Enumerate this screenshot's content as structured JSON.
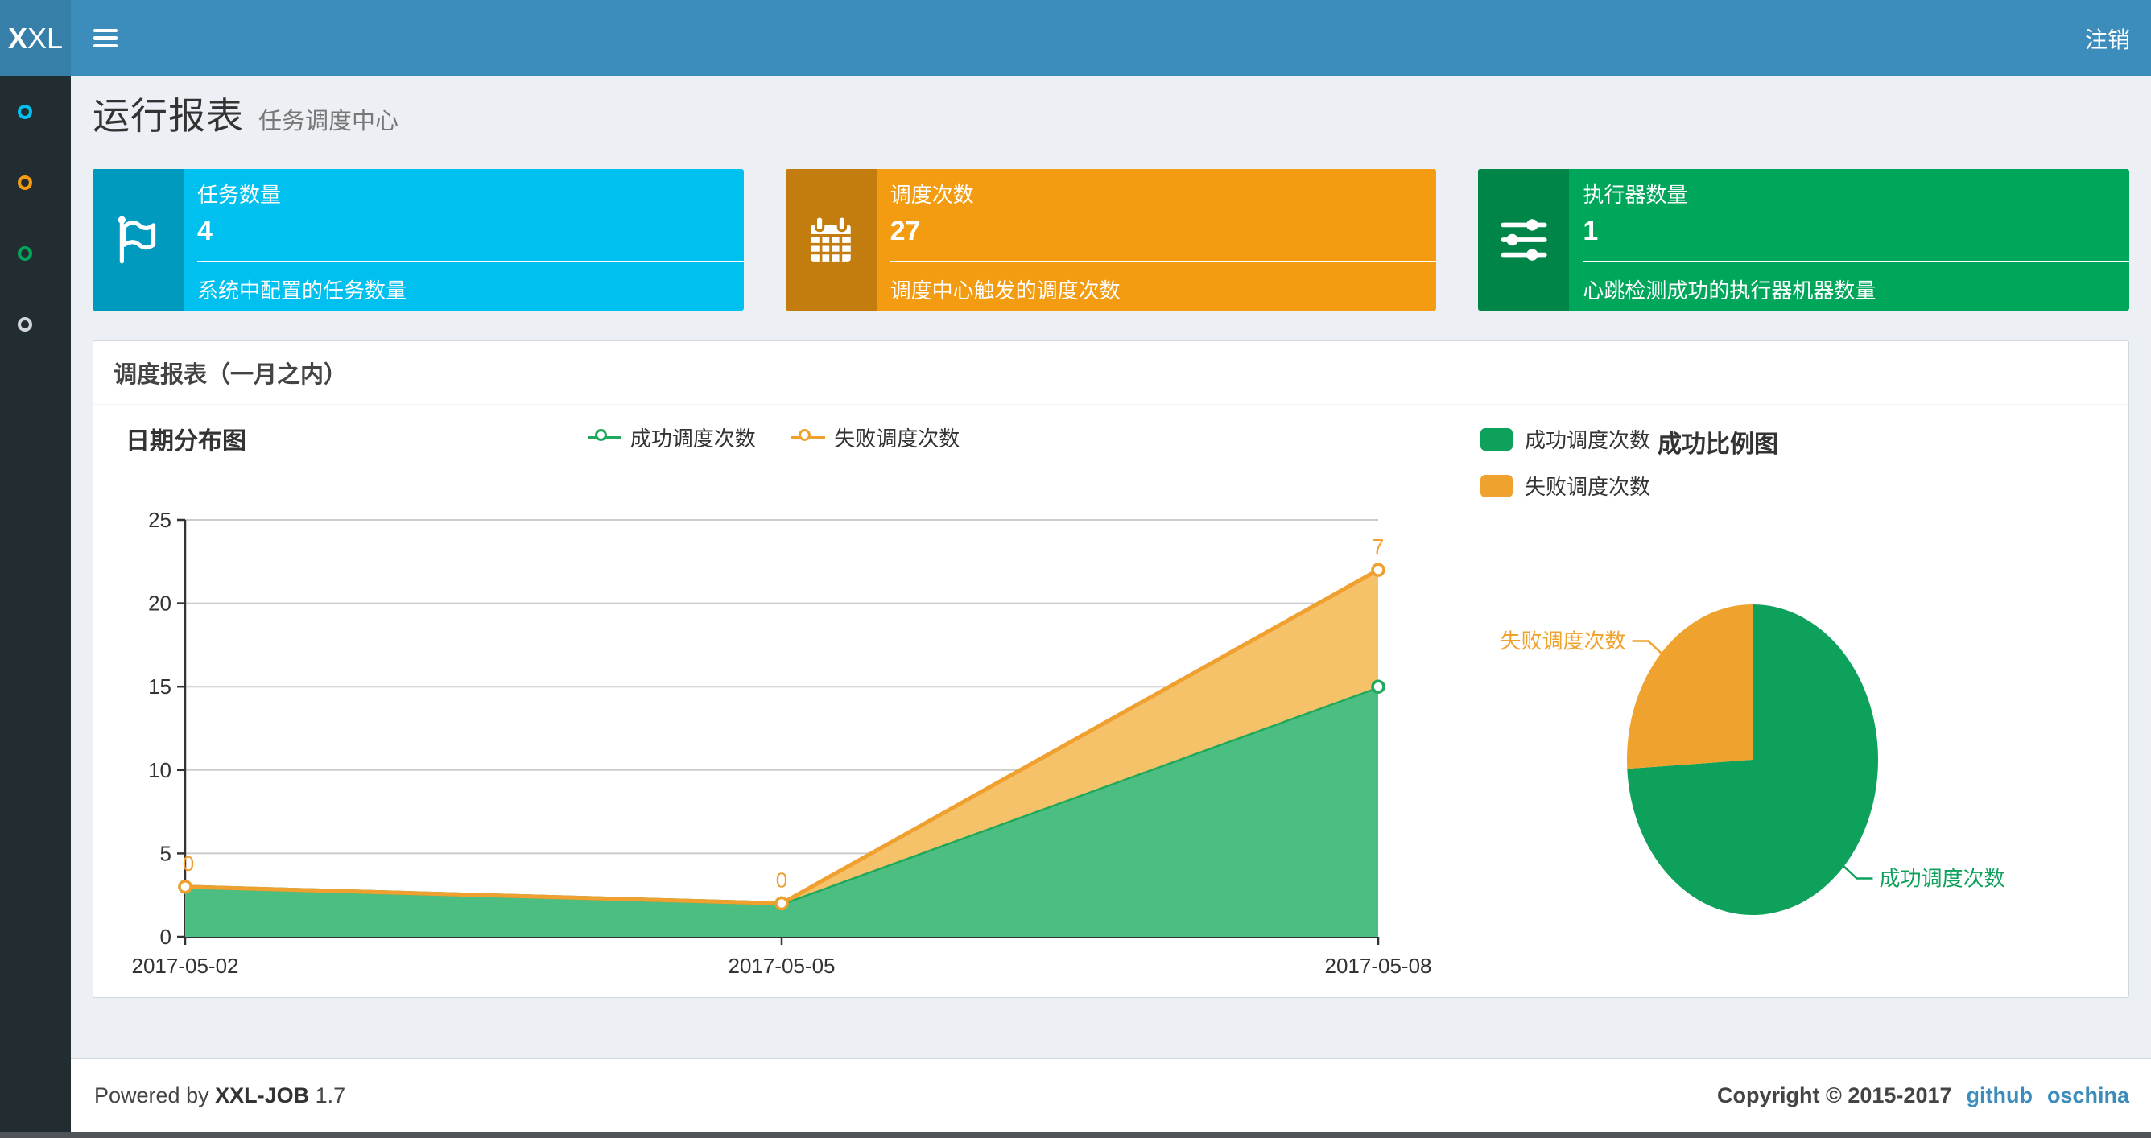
{
  "navbar": {
    "logo_bold": "X",
    "logo_rest": "XL",
    "logout_label": "注销",
    "bg_color": "#3c8dbc",
    "logo_bg_color": "#367fa9"
  },
  "sidebar": {
    "bg_color": "#222d32",
    "items": [
      {
        "icon": "circle-icon",
        "color": "#00c0ef"
      },
      {
        "icon": "circle-icon",
        "color": "#f39c12"
      },
      {
        "icon": "circle-icon",
        "color": "#00a65a"
      },
      {
        "icon": "circle-icon",
        "color": "#d2d6de"
      }
    ]
  },
  "page": {
    "title": "运行报表",
    "subtitle": "任务调度中心"
  },
  "stat_cards": [
    {
      "icon": "flag-icon",
      "title": "任务数量",
      "value": "4",
      "desc": "系统中配置的任务数量",
      "color": "#00c0ef",
      "icon_bg": "#009abf"
    },
    {
      "icon": "calendar-icon",
      "title": "调度次数",
      "value": "27",
      "desc": "调度中心触发的调度次数",
      "color": "#f39c12",
      "icon_bg": "#c27d0e"
    },
    {
      "icon": "sliders-icon",
      "title": "执行器数量",
      "value": "1",
      "desc": "心跳检测成功的执行器机器数量",
      "color": "#00a65a",
      "icon_bg": "#008548"
    }
  ],
  "panel": {
    "title": "调度报表（一月之内）"
  },
  "chart_data": [
    {
      "type": "area",
      "title": "日期分布图",
      "stacked": true,
      "categories": [
        "2017-05-02",
        "2017-05-05",
        "2017-05-08"
      ],
      "series": [
        {
          "name": "成功调度次数",
          "values": [
            3,
            2,
            15
          ],
          "color": "#1ea95d",
          "fill": "#4dbe82",
          "show_point_labels": false
        },
        {
          "name": "失败调度次数",
          "values": [
            0,
            0,
            7
          ],
          "color": "#efa02f",
          "fill": "#f5c169",
          "show_point_labels": true
        }
      ],
      "point_labels": [
        "0",
        "0",
        "7"
      ],
      "ylim": [
        0,
        25
      ],
      "yticks": [
        0,
        5,
        10,
        15,
        20,
        25
      ],
      "grid": true,
      "legend_position": "top-center",
      "xlabel": "",
      "ylabel": ""
    },
    {
      "type": "pie",
      "title": "成功比例图",
      "slices": [
        {
          "label": "成功调度次数",
          "value": 20,
          "color": "#0da15b"
        },
        {
          "label": "失败调度次数",
          "value": 7,
          "color": "#f0a22e"
        }
      ],
      "legend_position": "top-left"
    }
  ],
  "footer": {
    "powered_prefix": "Powered by",
    "brand": "XXL-JOB",
    "version": "1.7",
    "copyright": "Copyright © 2015-2017",
    "links": [
      {
        "label": "github"
      },
      {
        "label": "oschina"
      }
    ],
    "link_color": "#3c8dbc"
  }
}
